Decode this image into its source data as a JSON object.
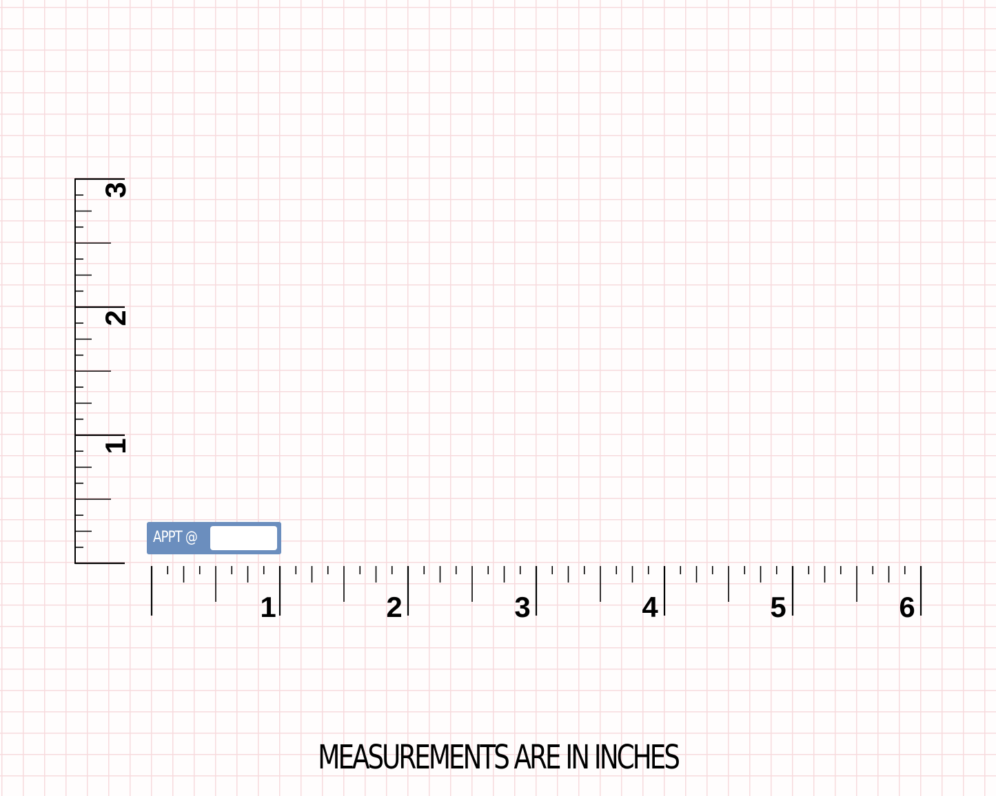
{
  "sticker": {
    "label": "APPT @"
  },
  "caption": "MEASUREMENTS ARE IN INCHES",
  "ruler_horizontal": {
    "unit": "inches",
    "max": 6,
    "labels": [
      "1",
      "2",
      "3",
      "4",
      "5",
      "6"
    ]
  },
  "ruler_vertical": {
    "unit": "inches",
    "max": 3,
    "labels": [
      "1",
      "2",
      "3"
    ]
  },
  "colors": {
    "grid": "#f7dadd",
    "background": "#fffdfd",
    "sticker": "#6b8ebe",
    "ink": "#000000"
  }
}
